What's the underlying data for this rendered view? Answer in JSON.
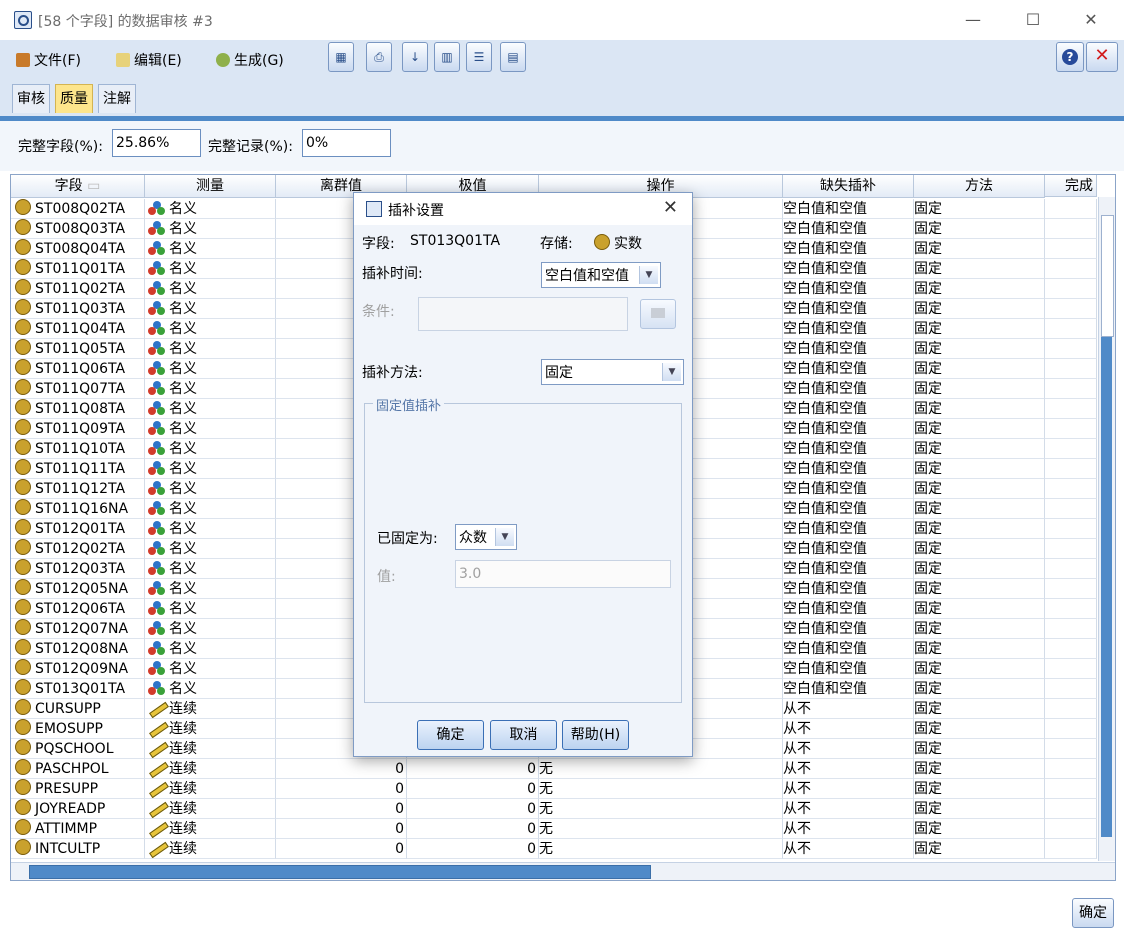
{
  "window": {
    "title": "[58 个字段] 的数据审核 #3",
    "min": "—",
    "max": "☐",
    "close": "✕"
  },
  "menu": {
    "file": "文件(F)",
    "edit": "编辑(E)",
    "generate": "生成(G)"
  },
  "tabs": [
    "审核",
    "质量",
    "注解"
  ],
  "fields": {
    "complete_fields_label": "完整字段(%):",
    "complete_fields_value": "25.86%",
    "complete_records_label": "完整记录(%):",
    "complete_records_value": "0%"
  },
  "grid": {
    "headers": [
      "字段",
      "测量",
      "离群值",
      "极值",
      "操作",
      "缺失插补",
      "方法",
      "完成"
    ],
    "rows": [
      {
        "field": "ST008Q02TA",
        "measure": "名义",
        "o": "",
        "e": "",
        "op": "",
        "impute": "空白值和空值",
        "method": "固定"
      },
      {
        "field": "ST008Q03TA",
        "measure": "名义",
        "o": "",
        "e": "",
        "op": "",
        "impute": "空白值和空值",
        "method": "固定"
      },
      {
        "field": "ST008Q04TA",
        "measure": "名义",
        "o": "",
        "e": "",
        "op": "",
        "impute": "空白值和空值",
        "method": "固定"
      },
      {
        "field": "ST011Q01TA",
        "measure": "名义",
        "o": "",
        "e": "",
        "op": "",
        "impute": "空白值和空值",
        "method": "固定"
      },
      {
        "field": "ST011Q02TA",
        "measure": "名义",
        "o": "",
        "e": "",
        "op": "",
        "impute": "空白值和空值",
        "method": "固定"
      },
      {
        "field": "ST011Q03TA",
        "measure": "名义",
        "o": "",
        "e": "",
        "op": "",
        "impute": "空白值和空值",
        "method": "固定"
      },
      {
        "field": "ST011Q04TA",
        "measure": "名义",
        "o": "",
        "e": "",
        "op": "",
        "impute": "空白值和空值",
        "method": "固定"
      },
      {
        "field": "ST011Q05TA",
        "measure": "名义",
        "o": "",
        "e": "",
        "op": "",
        "impute": "空白值和空值",
        "method": "固定"
      },
      {
        "field": "ST011Q06TA",
        "measure": "名义",
        "o": "",
        "e": "",
        "op": "",
        "impute": "空白值和空值",
        "method": "固定"
      },
      {
        "field": "ST011Q07TA",
        "measure": "名义",
        "o": "",
        "e": "",
        "op": "",
        "impute": "空白值和空值",
        "method": "固定"
      },
      {
        "field": "ST011Q08TA",
        "measure": "名义",
        "o": "",
        "e": "",
        "op": "",
        "impute": "空白值和空值",
        "method": "固定"
      },
      {
        "field": "ST011Q09TA",
        "measure": "名义",
        "o": "",
        "e": "",
        "op": "",
        "impute": "空白值和空值",
        "method": "固定"
      },
      {
        "field": "ST011Q10TA",
        "measure": "名义",
        "o": "",
        "e": "",
        "op": "",
        "impute": "空白值和空值",
        "method": "固定"
      },
      {
        "field": "ST011Q11TA",
        "measure": "名义",
        "o": "",
        "e": "",
        "op": "",
        "impute": "空白值和空值",
        "method": "固定"
      },
      {
        "field": "ST011Q12TA",
        "measure": "名义",
        "o": "",
        "e": "",
        "op": "",
        "impute": "空白值和空值",
        "method": "固定"
      },
      {
        "field": "ST011Q16NA",
        "measure": "名义",
        "o": "",
        "e": "",
        "op": "",
        "impute": "空白值和空值",
        "method": "固定"
      },
      {
        "field": "ST012Q01TA",
        "measure": "名义",
        "o": "",
        "e": "",
        "op": "",
        "impute": "空白值和空值",
        "method": "固定"
      },
      {
        "field": "ST012Q02TA",
        "measure": "名义",
        "o": "",
        "e": "",
        "op": "",
        "impute": "空白值和空值",
        "method": "固定"
      },
      {
        "field": "ST012Q03TA",
        "measure": "名义",
        "o": "",
        "e": "",
        "op": "",
        "impute": "空白值和空值",
        "method": "固定"
      },
      {
        "field": "ST012Q05NA",
        "measure": "名义",
        "o": "",
        "e": "",
        "op": "",
        "impute": "空白值和空值",
        "method": "固定"
      },
      {
        "field": "ST012Q06TA",
        "measure": "名义",
        "o": "",
        "e": "",
        "op": "",
        "impute": "空白值和空值",
        "method": "固定"
      },
      {
        "field": "ST012Q07NA",
        "measure": "名义",
        "o": "",
        "e": "",
        "op": "",
        "impute": "空白值和空值",
        "method": "固定"
      },
      {
        "field": "ST012Q08NA",
        "measure": "名义",
        "o": "",
        "e": "",
        "op": "",
        "impute": "空白值和空值",
        "method": "固定"
      },
      {
        "field": "ST012Q09NA",
        "measure": "名义",
        "o": "",
        "e": "",
        "op": "",
        "impute": "空白值和空值",
        "method": "固定"
      },
      {
        "field": "ST013Q01TA",
        "measure": "名义",
        "o": "",
        "e": "",
        "op": "",
        "impute": "空白值和空值",
        "method": "固定"
      },
      {
        "field": "CURSUPP",
        "measure": "连续",
        "o": "",
        "e": "",
        "op": "",
        "impute": "从不",
        "method": "固定"
      },
      {
        "field": "EMOSUPP",
        "measure": "连续",
        "o": "",
        "e": "",
        "op": "",
        "impute": "从不",
        "method": "固定"
      },
      {
        "field": "PQSCHOOL",
        "measure": "连续",
        "o": "",
        "e": "",
        "op": "",
        "impute": "从不",
        "method": "固定"
      },
      {
        "field": "PASCHPOL",
        "measure": "连续",
        "o": "0",
        "e": "0",
        "op": "无",
        "impute": "从不",
        "method": "固定"
      },
      {
        "field": "PRESUPP",
        "measure": "连续",
        "o": "0",
        "e": "0",
        "op": "无",
        "impute": "从不",
        "method": "固定"
      },
      {
        "field": "JOYREADP",
        "measure": "连续",
        "o": "0",
        "e": "0",
        "op": "无",
        "impute": "从不",
        "method": "固定"
      },
      {
        "field": "ATTIMMP",
        "measure": "连续",
        "o": "0",
        "e": "0",
        "op": "无",
        "impute": "从不",
        "method": "固定"
      },
      {
        "field": "INTCULTP",
        "measure": "连续",
        "o": "0",
        "e": "0",
        "op": "无",
        "impute": "从不",
        "method": "固定"
      }
    ]
  },
  "dialog": {
    "title": "插补设置",
    "field_label": "字段:",
    "field_value": "ST013Q01TA",
    "storage_label": "存储:",
    "storage_value": "实数",
    "impute_when_label": "插补时间:",
    "impute_when_value": "空白值和空值",
    "condition_label": "条件:",
    "condition_value": "",
    "impute_method_label": "插补方法:",
    "impute_method_value": "固定",
    "group_label": "固定值插补",
    "fixed_as_label": "已固定为:",
    "fixed_as_value": "众数",
    "value_label": "值:",
    "value_value": "3.0",
    "ok": "确定",
    "cancel": "取消",
    "help": "帮助(H)"
  },
  "bottom_ok": "确定",
  "colors": {
    "accent": "#4f8ac8",
    "tab_active": "#fde58c",
    "toolbar": "#dbe6f4"
  }
}
